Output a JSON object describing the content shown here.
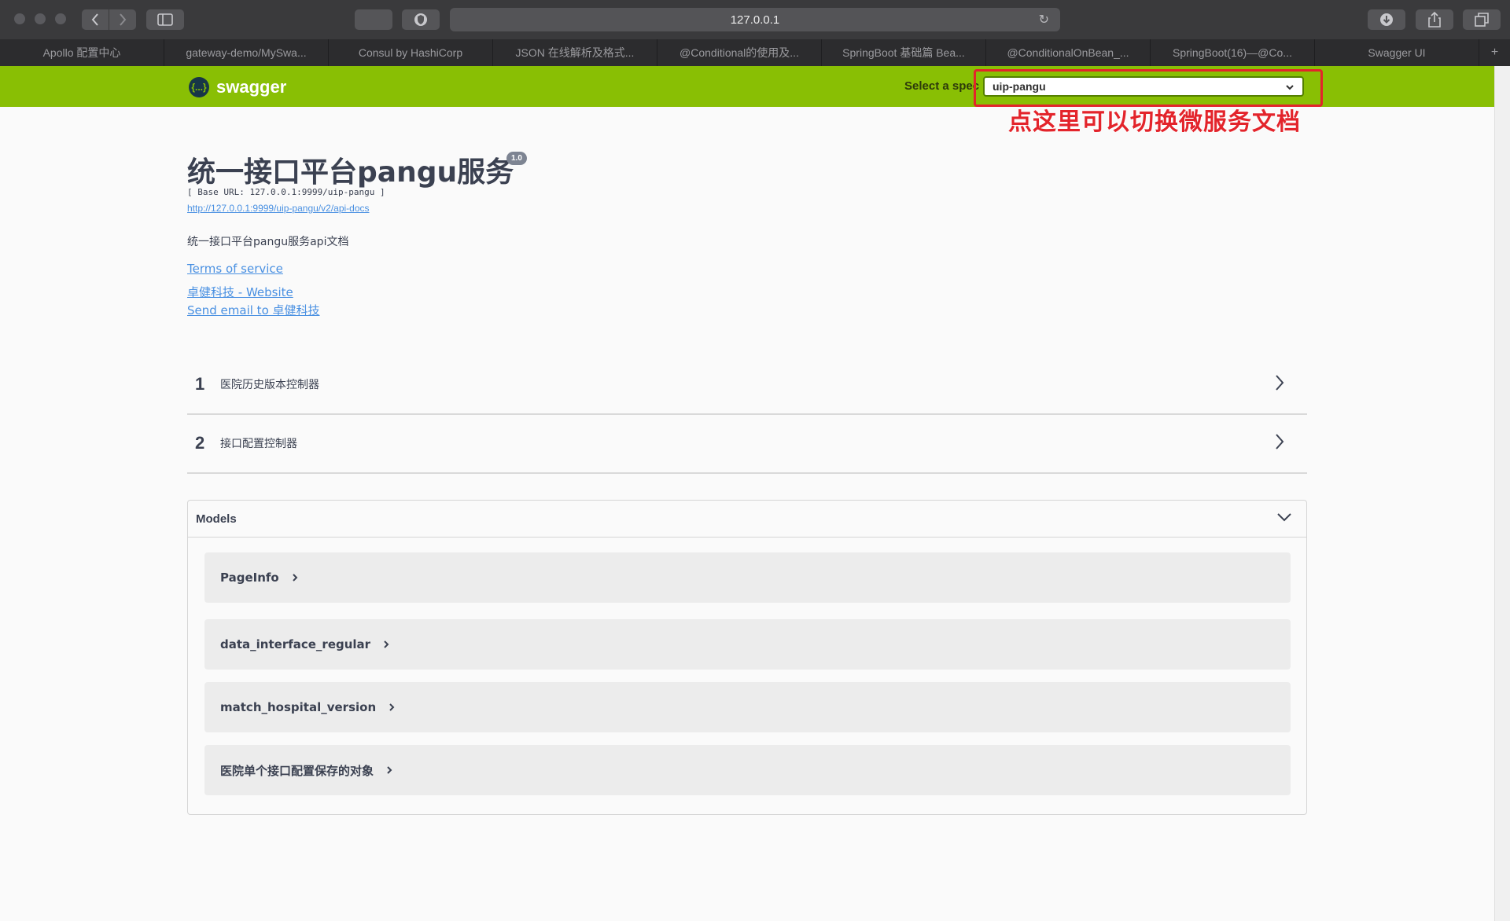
{
  "browser": {
    "url": "127.0.0.1",
    "tabs": [
      "Apollo 配置中心",
      "gateway-demo/MySwa...",
      "Consul by HashiCorp",
      "JSON 在线解析及格式...",
      "@Conditional的使用及...",
      "SpringBoot 基础篇 Bea...",
      "@ConditionalOnBean_...",
      "SpringBoot(16)—@Co...",
      "Swagger UI"
    ],
    "new_tab": "+"
  },
  "topbar": {
    "logo_text": "swagger",
    "logo_mark": "{...}",
    "spec_label": "Select a spec",
    "spec_value": "uip-pangu",
    "bar_color": "#89bf04"
  },
  "annotation": {
    "text": "点这里可以切换微服务文档",
    "color": "#e3242b"
  },
  "info": {
    "title": "统一接口平台pangu服务",
    "version": "1.0",
    "base_url": "[ Base URL: 127.0.0.1:9999/uip-pangu ]",
    "api_docs_link": "http://127.0.0.1:9999/uip-pangu/v2/api-docs",
    "description": "统一接口平台pangu服务api文档",
    "terms": "Terms of service",
    "website": "卓健科技 - Website",
    "email": "Send email to 卓健科技"
  },
  "groups": [
    {
      "number": "1",
      "name": "医院历史版本控制器"
    },
    {
      "number": "2",
      "name": "接口配置控制器"
    }
  ],
  "models": {
    "title": "Models",
    "items": [
      "PageInfo",
      "data_interface_regular",
      "match_hospital_version",
      "医院单个接口配置保存的对象"
    ]
  }
}
